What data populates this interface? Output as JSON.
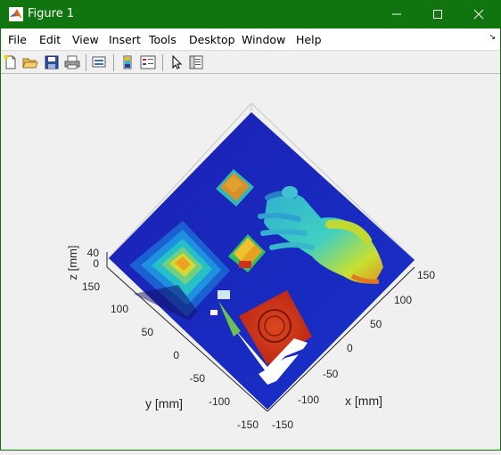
{
  "window": {
    "title": "Figure 1"
  },
  "menu": [
    "File",
    "Edit",
    "View",
    "Insert",
    "Tools",
    "Desktop",
    "Window",
    "Help"
  ],
  "toolbar": {
    "buttons": [
      "new-figure",
      "open-file",
      "save",
      "print",
      "link-plot",
      "insert-colorbar",
      "insert-legend",
      "edit-plot",
      "property-inspector"
    ]
  },
  "plot": {
    "zlabel": "z [mm]",
    "ylabel": "y [mm]",
    "xlabel": "x [mm]",
    "z_ticks": [
      "40",
      "0"
    ],
    "y_ticks": [
      "150",
      "100",
      "50",
      "0",
      "-50",
      "-100",
      "-150"
    ],
    "x_ticks": [
      "150",
      "100",
      "50",
      "0",
      "-50",
      "-100",
      "-150"
    ]
  },
  "colors": {
    "titlebar": "#10740f",
    "surface_base": "#1a1fae"
  }
}
